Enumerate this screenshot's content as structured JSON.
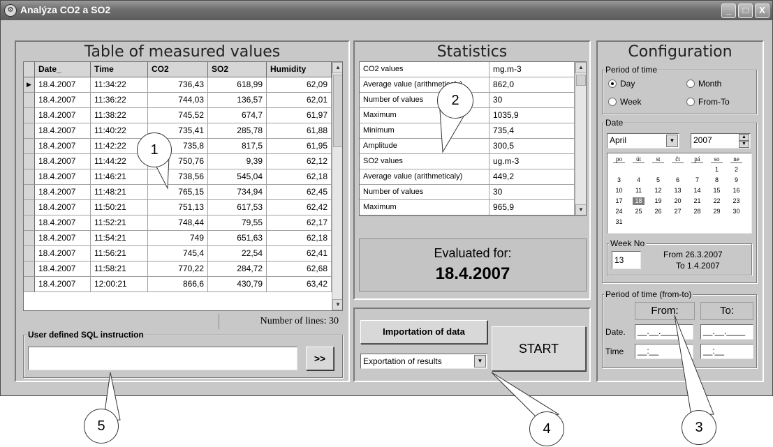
{
  "window": {
    "title": "Analýza CO2 a SO2",
    "controls": {
      "minimize": "_",
      "maximize": "□",
      "close": "X"
    }
  },
  "table_panel": {
    "title": "Table of measured values",
    "columns": [
      "Date_",
      "Time",
      "CO2",
      "SO2",
      "Humidity"
    ],
    "rows": [
      [
        "18.4.2007",
        "11:34:22",
        "736,43",
        "618,99",
        "62,09"
      ],
      [
        "18.4.2007",
        "11:36:22",
        "744,03",
        "136,57",
        "62,01"
      ],
      [
        "18.4.2007",
        "11:38:22",
        "745,52",
        "674,7",
        "61,97"
      ],
      [
        "18.4.2007",
        "11:40:22",
        "735,41",
        "285,78",
        "61,88"
      ],
      [
        "18.4.2007",
        "11:42:22",
        "735,8",
        "817,5",
        "61,95"
      ],
      [
        "18.4.2007",
        "11:44:22",
        "750,76",
        "9,39",
        "62,12"
      ],
      [
        "18.4.2007",
        "11:46:21",
        "738,56",
        "545,04",
        "62,18"
      ],
      [
        "18.4.2007",
        "11:48:21",
        "765,15",
        "734,94",
        "62,45"
      ],
      [
        "18.4.2007",
        "11:50:21",
        "751,13",
        "617,53",
        "62,42"
      ],
      [
        "18.4.2007",
        "11:52:21",
        "748,44",
        "79,55",
        "62,17"
      ],
      [
        "18.4.2007",
        "11:54:21",
        "749",
        "651,63",
        "62,18"
      ],
      [
        "18.4.2007",
        "11:56:21",
        "745,4",
        "22,54",
        "62,41"
      ],
      [
        "18.4.2007",
        "11:58:21",
        "770,22",
        "284,72",
        "62,68"
      ],
      [
        "18.4.2007",
        "12:00:21",
        "866,6",
        "430,79",
        "63,42"
      ]
    ],
    "number_of_lines": "Number of lines: 30",
    "sql_label": "User defined SQL instruction",
    "sql_value": "",
    "sql_button": ">>"
  },
  "statistics_panel": {
    "title": "Statistics",
    "rows": [
      [
        "CO2 values",
        "mg.m-3"
      ],
      [
        "Average value (arithmeticaly)",
        "862,0"
      ],
      [
        "Number of values",
        "30"
      ],
      [
        "Maximum",
        "1035,9"
      ],
      [
        "Minimum",
        "735,4"
      ],
      [
        "Amplitude",
        "300,5"
      ],
      [
        "SO2 values",
        "ug.m-3"
      ],
      [
        "Average value (arithmeticaly)",
        "449,2"
      ],
      [
        "Number of values",
        "30"
      ],
      [
        "Maximum",
        "965,9"
      ]
    ],
    "evaluated_label": "Evaluated for:",
    "evaluated_date": "18.4.2007"
  },
  "actions_panel": {
    "import_button": "Importation of data",
    "export_select": "Exportation of results",
    "start_button": "START"
  },
  "configuration_panel": {
    "title": "Configuration",
    "period_label": "Period of time",
    "period_options": [
      "Day",
      "Month",
      "Week",
      "From-To"
    ],
    "period_selected": "Day",
    "date_label": "Date",
    "month": "April",
    "year": "2007",
    "weekdays": [
      "po",
      "út",
      "st",
      "čt",
      "pá",
      "so",
      "ne"
    ],
    "weeks": [
      [
        "",
        "",
        "",
        "",
        "",
        "1",
        "2"
      ],
      [
        "3",
        "4",
        "5",
        "6",
        "7",
        "8",
        "9"
      ],
      [
        "10",
        "11",
        "12",
        "13",
        "14",
        "15",
        "16"
      ],
      [
        "17",
        "18",
        "19",
        "20",
        "21",
        "22",
        "23"
      ],
      [
        "24",
        "25",
        "26",
        "27",
        "28",
        "29",
        "30"
      ],
      [
        "31",
        "",
        "",
        "",
        "",
        "",
        ""
      ]
    ],
    "selected_day": "18",
    "week_no_label": "Week No",
    "week_no": "13",
    "week_from": "From 26.3.2007",
    "week_to": "To 1.4.2007",
    "from_to_label": "Period of time (from-to)",
    "from_label": "From:",
    "to_label": "To:",
    "date_row_label": "Date.",
    "time_row_label": "Time",
    "date_from": "__.__.____",
    "date_to": "__.__.____",
    "time_from": "__:__",
    "time_to": "__:__"
  },
  "callouts": [
    "1",
    "2",
    "3",
    "4",
    "5"
  ]
}
